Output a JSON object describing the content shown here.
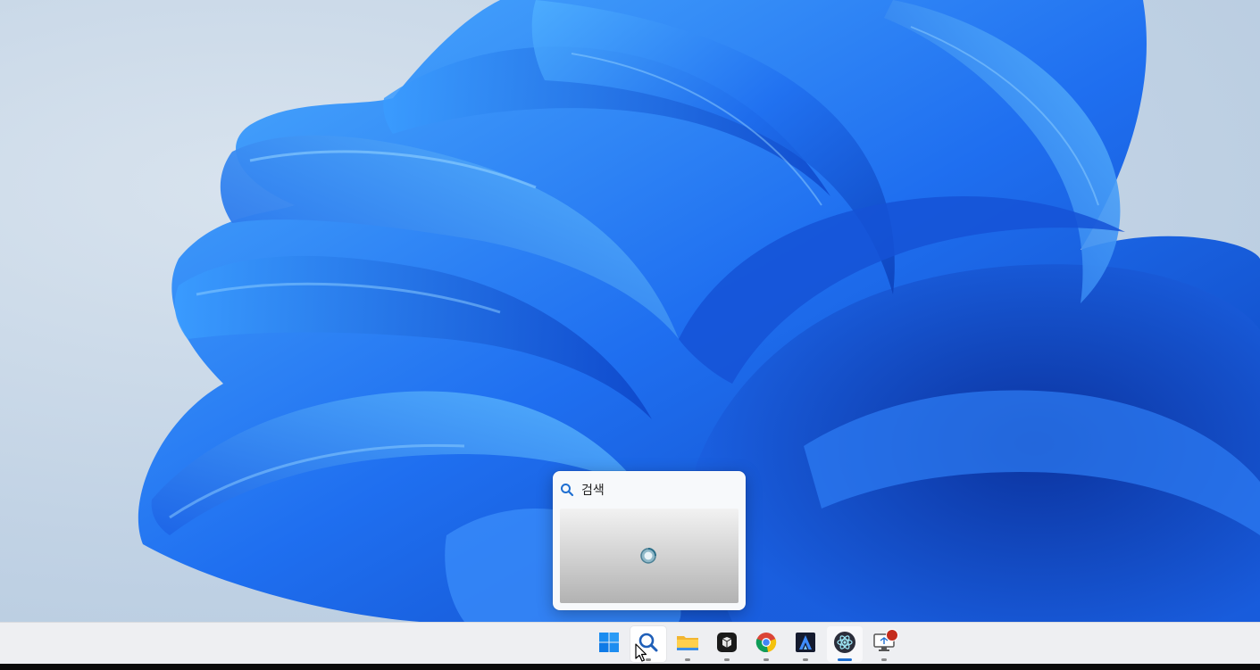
{
  "search_flyout": {
    "title": "검색",
    "title_icon": "search-icon",
    "preview_state": "loading"
  },
  "taskbar": {
    "items": [
      {
        "name": "start-button",
        "icon": "windows-logo-icon",
        "state": "normal"
      },
      {
        "name": "search-button",
        "icon": "search-icon",
        "state": "hover"
      },
      {
        "name": "file-explorer-button",
        "icon": "folder-icon",
        "state": "running"
      },
      {
        "name": "app-box-button",
        "icon": "black-box-app-icon",
        "state": "running"
      },
      {
        "name": "chrome-button",
        "icon": "chrome-icon",
        "state": "running"
      },
      {
        "name": "arduino-like-button",
        "icon": "a-logo-icon",
        "state": "running"
      },
      {
        "name": "electron-button",
        "icon": "electron-icon",
        "state": "active"
      },
      {
        "name": "remote-desktop-button",
        "icon": "monitor-icon",
        "state": "running",
        "badge": true
      }
    ]
  },
  "colors": {
    "accent": "#1f6fd1",
    "taskbar_bg": "#eeeff2",
    "badge": "#c42b1c"
  }
}
